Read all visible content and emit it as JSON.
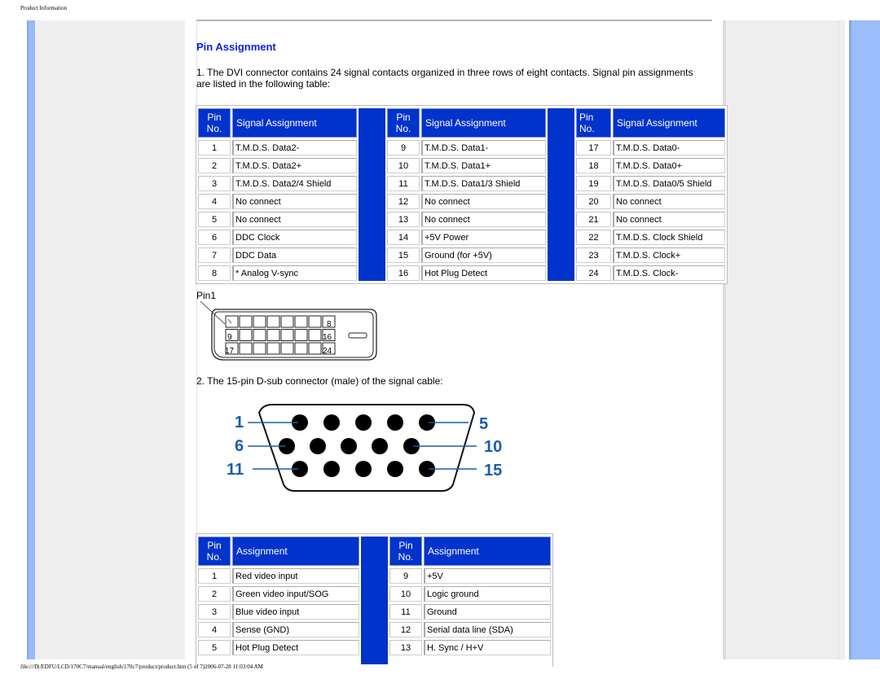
{
  "page": {
    "header_text": "Product Information",
    "footer_text": "file:///D|/EDFU/LCD/170C7/manual/english/170c7/product/product.htm (5 of 7)2006-07-28 11:03:04 AM"
  },
  "content": {
    "title": "Pin Assignment",
    "para1": "1. The DVI connector contains 24 signal contacts organized in three rows of eight contacts. Signal pin assignments are listed in the following table:",
    "para2": "2. The 15-pin D-sub connector (male) of the signal cable:"
  },
  "dvi_table": {
    "pin_header": "Pin No.",
    "pin_header_line1": "Pin",
    "pin_header_line2": "No.",
    "signal_header": "Signal Assignment",
    "columns": [
      [
        {
          "pin": "1",
          "signal": "T.M.D.S. Data2-"
        },
        {
          "pin": "2",
          "signal": "T.M.D.S. Data2+"
        },
        {
          "pin": "3",
          "signal": "T.M.D.S. Data2/4 Shield"
        },
        {
          "pin": "4",
          "signal": "No connect"
        },
        {
          "pin": "5",
          "signal": "No connect"
        },
        {
          "pin": "6",
          "signal": "DDC Clock"
        },
        {
          "pin": "7",
          "signal": "DDC Data"
        },
        {
          "pin": "8",
          "signal": "* Analog V-sync"
        }
      ],
      [
        {
          "pin": "9",
          "signal": "T.M.D.S. Data1-"
        },
        {
          "pin": "10",
          "signal": "T.M.D.S. Data1+"
        },
        {
          "pin": "11",
          "signal": "T.M.D.S. Data1/3 Shield"
        },
        {
          "pin": "12",
          "signal": "No connect"
        },
        {
          "pin": "13",
          "signal": "No connect"
        },
        {
          "pin": "14",
          "signal": "+5V Power"
        },
        {
          "pin": "15",
          "signal": "Ground (for +5V)"
        },
        {
          "pin": "16",
          "signal": "Hot Plug Detect"
        }
      ],
      [
        {
          "pin": "17",
          "signal": "T.M.D.S. Data0-"
        },
        {
          "pin": "18",
          "signal": "T.M.D.S. Data0+"
        },
        {
          "pin": "19",
          "signal": "T.M.D.S. Data0/5 Shield"
        },
        {
          "pin": "20",
          "signal": "No connect"
        },
        {
          "pin": "21",
          "signal": "No connect"
        },
        {
          "pin": "22",
          "signal": "T.M.D.S. Clock Shield"
        },
        {
          "pin": "23",
          "signal": "T.M.D.S. Clock+"
        },
        {
          "pin": "24",
          "signal": "T.M.D.S. Clock-"
        }
      ]
    ]
  },
  "dvi_diagram": {
    "pin1_label": "Pin1",
    "row_labels_left": [
      "",
      "9",
      "17"
    ],
    "row_labels_right": [
      "8",
      "16",
      "24"
    ]
  },
  "vga_diagram": {
    "labels_left": [
      "1",
      "6",
      "11"
    ],
    "labels_right": [
      "5",
      "10",
      "15"
    ],
    "label_color": "#1a5ea8"
  },
  "vga_table": {
    "pin_header_line1": "Pin",
    "pin_header_line2": "No.",
    "assignment_header": "Assignment",
    "columns": [
      [
        {
          "pin": "1",
          "signal": "Red video input"
        },
        {
          "pin": "2",
          "signal": "Green video input/SOG"
        },
        {
          "pin": "3",
          "signal": "Blue video input"
        },
        {
          "pin": "4",
          "signal": "Sense (GND)"
        },
        {
          "pin": "5",
          "signal": "Hot Plug Detect"
        }
      ],
      [
        {
          "pin": "9",
          "signal": "+5V"
        },
        {
          "pin": "10",
          "signal": "Logic ground"
        },
        {
          "pin": "11",
          "signal": "Ground"
        },
        {
          "pin": "12",
          "signal": "Serial data line (SDA)"
        },
        {
          "pin": "13",
          "signal": "H. Sync / H+V"
        }
      ]
    ]
  },
  "colors": {
    "header_blue": "#0033cc",
    "title_blue": "#0a1ce8",
    "sidebar_blue": "#99bbf7"
  }
}
